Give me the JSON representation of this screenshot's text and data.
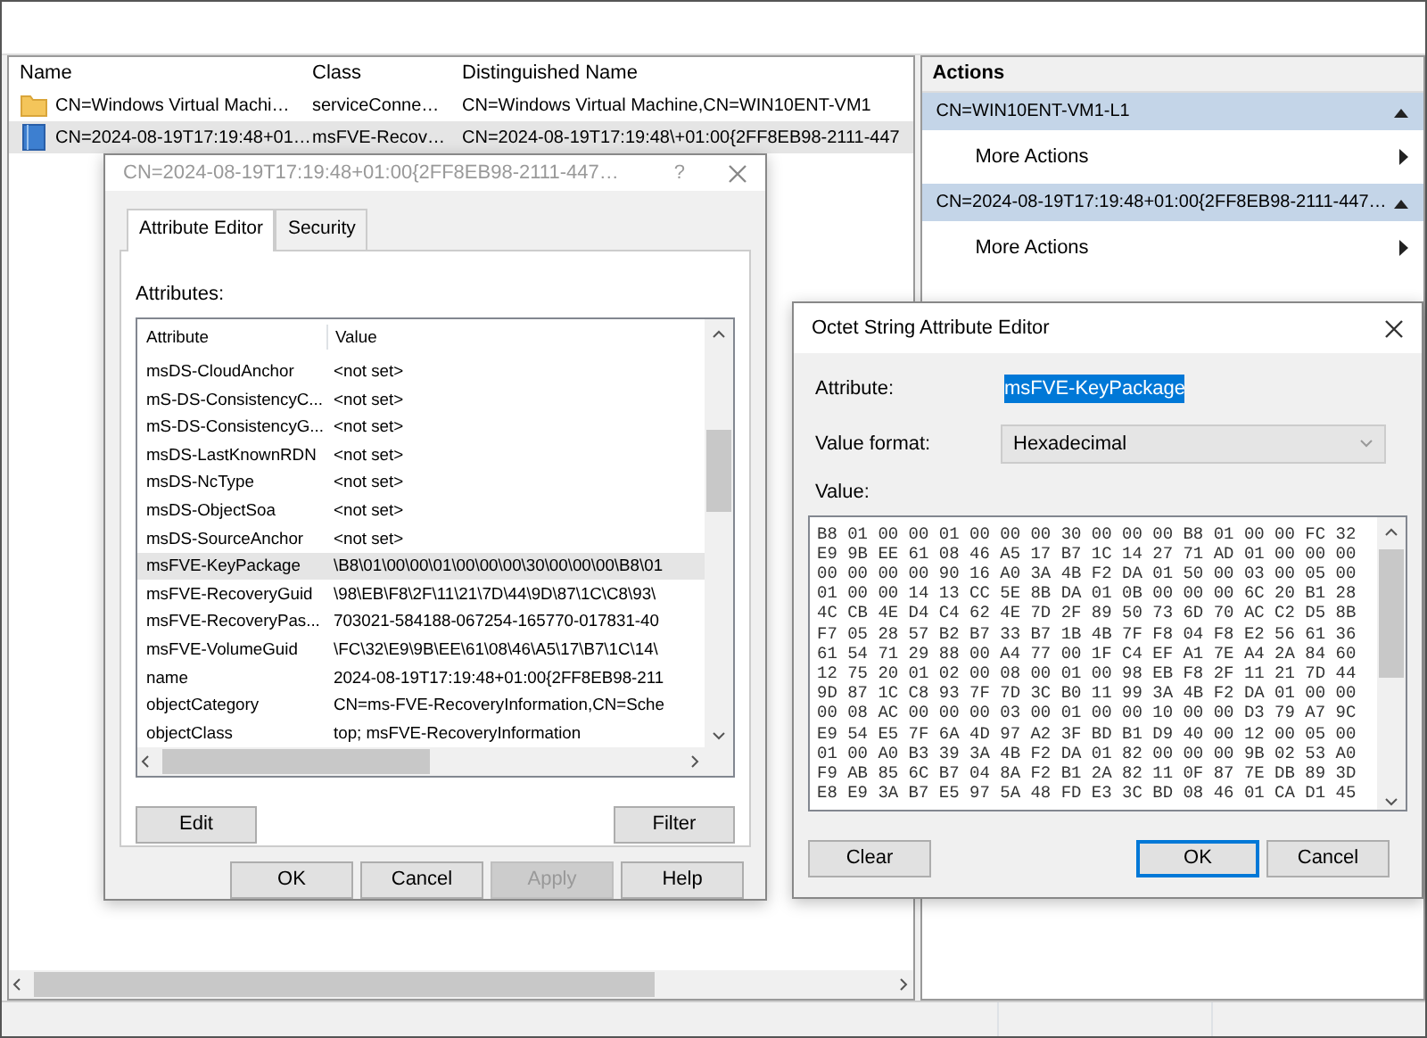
{
  "main_list": {
    "columns": [
      "Name",
      "Class",
      "Distinguished Name"
    ],
    "rows": [
      {
        "kind": "folder",
        "name": "CN=Windows Virtual Machi…",
        "class": "serviceConne…",
        "dn": "CN=Windows Virtual Machine,CN=WIN10ENT-VM1",
        "selected": false
      },
      {
        "kind": "recovery",
        "name": "CN=2024-08-19T17:19:48+01…",
        "class": "msFVE-Recov…",
        "dn": "CN=2024-08-19T17:19:48\\+01:00{2FF8EB98-2111-447",
        "selected": true
      }
    ]
  },
  "actions": {
    "title": "Actions",
    "groups": [
      {
        "title": "CN=WIN10ENT-VM1-L1",
        "expanded": true,
        "items": [
          "More Actions"
        ]
      },
      {
        "title": "CN=2024-08-19T17:19:48+01:00{2FF8EB98-2111-447…",
        "expanded": true,
        "items": [
          "More Actions"
        ]
      }
    ]
  },
  "properties_dialog": {
    "title": "CN=2024-08-19T17:19:48+01:00{2FF8EB98-2111-447…",
    "help": "?",
    "tabs": [
      {
        "label": "Attribute Editor",
        "selected": true
      },
      {
        "label": "Security",
        "selected": false
      }
    ],
    "attributes_label": "Attributes:",
    "columns": [
      "Attribute",
      "Value"
    ],
    "rows": [
      {
        "attribute": "msDS-CloudAnchor",
        "value": "<not set>",
        "selected": false
      },
      {
        "attribute": "mS-DS-ConsistencyC...",
        "value": "<not set>",
        "selected": false
      },
      {
        "attribute": "mS-DS-ConsistencyG...",
        "value": "<not set>",
        "selected": false
      },
      {
        "attribute": "msDS-LastKnownRDN",
        "value": "<not set>",
        "selected": false
      },
      {
        "attribute": "msDS-NcType",
        "value": "<not set>",
        "selected": false
      },
      {
        "attribute": "msDS-ObjectSoa",
        "value": "<not set>",
        "selected": false
      },
      {
        "attribute": "msDS-SourceAnchor",
        "value": "<not set>",
        "selected": false
      },
      {
        "attribute": "msFVE-KeyPackage",
        "value": "\\B8\\01\\00\\00\\01\\00\\00\\00\\30\\00\\00\\00\\B8\\01",
        "selected": true
      },
      {
        "attribute": "msFVE-RecoveryGuid",
        "value": "\\98\\EB\\F8\\2F\\11\\21\\7D\\44\\9D\\87\\1C\\C8\\93\\",
        "selected": false
      },
      {
        "attribute": "msFVE-RecoveryPas...",
        "value": "703021-584188-067254-165770-017831-40",
        "selected": false
      },
      {
        "attribute": "msFVE-VolumeGuid",
        "value": "\\FC\\32\\E9\\9B\\EE\\61\\08\\46\\A5\\17\\B7\\1C\\14\\",
        "selected": false
      },
      {
        "attribute": "name",
        "value": "2024-08-19T17:19:48+01:00{2FF8EB98-211",
        "selected": false
      },
      {
        "attribute": "objectCategory",
        "value": "CN=ms-FVE-RecoveryInformation,CN=Sche",
        "selected": false
      },
      {
        "attribute": "objectClass",
        "value": "top; msFVE-RecoveryInformation",
        "selected": false
      }
    ],
    "list_buttons": [
      "Edit",
      "Filter"
    ],
    "buttons": [
      {
        "label": "OK",
        "disabled": false
      },
      {
        "label": "Cancel",
        "disabled": false
      },
      {
        "label": "Apply",
        "disabled": true
      },
      {
        "label": "Help",
        "disabled": false
      }
    ]
  },
  "octet_dialog": {
    "title": "Octet String Attribute Editor",
    "attribute_label": "Attribute:",
    "attribute_value": "msFVE-KeyPackage",
    "attribute_selected": true,
    "value_format_label": "Value format:",
    "value_format": "Hexadecimal",
    "value_label": "Value:",
    "hex_lines": [
      "B8 01 00 00 01 00 00 00 30 00 00 00 B8 01 00 00 FC 32",
      "E9 9B EE 61 08 46 A5 17 B7 1C 14 27 71 AD 01 00 00 00",
      "00 00 00 00 90 16 A0 3A 4B F2 DA 01 50 00 03 00 05 00",
      "01 00 00 14 13 CC 5E 8B DA 01 0B 00 00 00 6C 20 B1 28",
      "4C CB 4E D4 C4 62 4E 7D 2F 89 50 73 6D 70 AC C2 D5 8B",
      "F7 05 28 57 B2 B7 33 B7 1B 4B 7F F8 04 F8 E2 56 61 36",
      "61 54 71 29 88 00 A4 77 00 1F C4 EF A1 7E A4 2A 84 60",
      "12 75 20 01 02 00 08 00 01 00 98 EB F8 2F 11 21 7D 44",
      "9D 87 1C C8 93 7F 7D 3C B0 11 99 3A 4B F2 DA 01 00 00",
      "00 08 AC 00 00 00 03 00 01 00 00 10 00 00 D3 79 A7 9C",
      "E9 54 E5 7F 6A 4D 97 A2 3F BD B1 D9 40 00 12 00 05 00",
      "01 00 A0 B3 39 3A 4B F2 DA 01 82 00 00 00 9B 02 53 A0",
      "F9 AB 85 6C B7 04 8A F2 B1 2A 82 11 0F 87 7E DB 89 3D",
      "E8 E9 3A B7 E5 97 5A 48 FD E3 3C BD 08 46 01 CA D1 45"
    ],
    "buttons": [
      {
        "label": "Clear",
        "default": false
      },
      {
        "label": "OK",
        "default": true
      },
      {
        "label": "Cancel",
        "default": false
      }
    ]
  }
}
